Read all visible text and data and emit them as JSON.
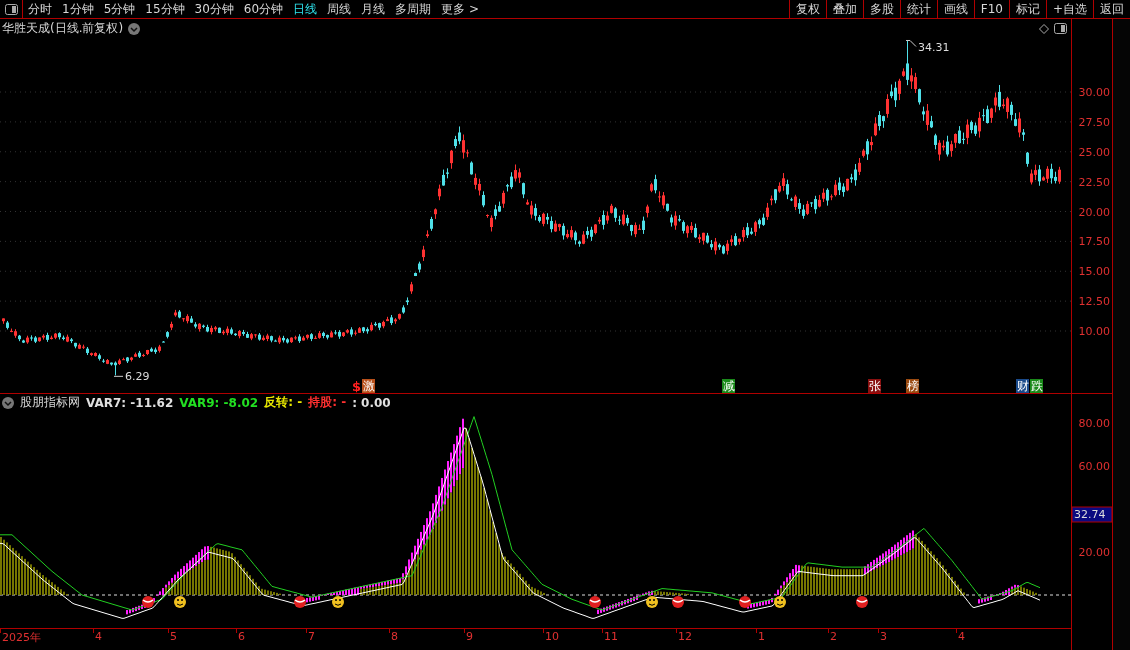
{
  "toolbar": {
    "periods": [
      {
        "label": "分时",
        "selected": false
      },
      {
        "label": "1分钟",
        "selected": false
      },
      {
        "label": "5分钟",
        "selected": false
      },
      {
        "label": "15分钟",
        "selected": false
      },
      {
        "label": "30分钟",
        "selected": false
      },
      {
        "label": "60分钟",
        "selected": false
      },
      {
        "label": "日线",
        "selected": true
      },
      {
        "label": "周线",
        "selected": false
      },
      {
        "label": "月线",
        "selected": false
      },
      {
        "label": "多周期",
        "selected": false
      },
      {
        "label": "更多 >",
        "selected": false
      }
    ],
    "buttons": [
      "复权",
      "叠加",
      "多股",
      "统计",
      "画线",
      "F10",
      "标记",
      "+自选",
      "返回"
    ]
  },
  "chart": {
    "title": "华胜天成(日线.前复权)",
    "high_label": "34.31",
    "low_label": "6.29",
    "price_ticks": [
      "30.00",
      "27.50",
      "25.00",
      "22.50",
      "20.00",
      "17.50",
      "15.00",
      "12.50",
      "10.00"
    ],
    "signals": [
      {
        "text": "$",
        "kind": "glyph",
        "color": "#ff2020"
      },
      {
        "text": "激",
        "kind": "tag",
        "color": "#b8501a"
      },
      {
        "text": "减",
        "kind": "tag",
        "color": "#1a8a1a"
      },
      {
        "text": "张",
        "kind": "tag",
        "color": "#8a1010"
      },
      {
        "text": "榜",
        "kind": "tag",
        "color": "#9a4a10"
      },
      {
        "text": "财",
        "kind": "tag",
        "color": "#1a4a8a"
      },
      {
        "text": "跌",
        "kind": "tag",
        "color": "#1a8a1a"
      }
    ]
  },
  "indicator": {
    "name": "股朋指标网",
    "values": [
      {
        "text": "VAR7: -11.62",
        "color": "#e0e0e0"
      },
      {
        "text": "VAR9: -8.02",
        "color": "#22e022"
      },
      {
        "text": "反转: -",
        "color": "#e8e800"
      },
      {
        "text": "持股: -",
        "color": "#ff3030"
      },
      {
        "text": ": 0.00",
        "color": "#e0e0e0"
      }
    ],
    "ticks": [
      "80.00",
      "60.00",
      "20.00"
    ],
    "current": "32.74"
  },
  "time_axis": [
    "2025年",
    "4",
    "5",
    "6",
    "7",
    "8",
    "9",
    "10",
    "11",
    "12",
    "1",
    "2",
    "3",
    "4"
  ]
}
